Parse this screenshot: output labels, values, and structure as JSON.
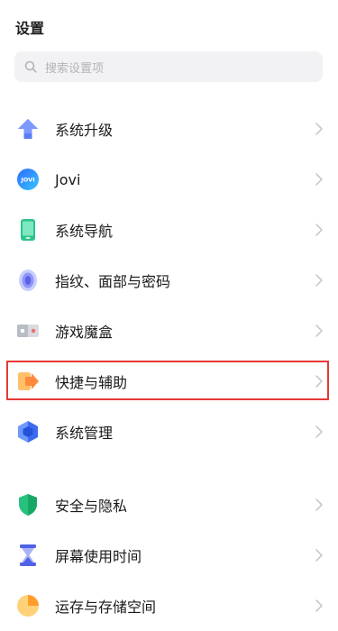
{
  "header": {
    "title": "设置"
  },
  "search": {
    "placeholder": "搜索设置项"
  },
  "items": [
    {
      "id": "system-upgrade",
      "label": "系统升级",
      "icon": "upgrade-arrow-icon"
    },
    {
      "id": "jovi",
      "label": "Jovi",
      "icon": "jovi-icon",
      "icon_text": "JOVI"
    },
    {
      "id": "system-navigation",
      "label": "系统导航",
      "icon": "phone-nav-icon"
    },
    {
      "id": "fingerprint-face-password",
      "label": "指纹、面部与密码",
      "icon": "fingerprint-icon"
    },
    {
      "id": "game-box",
      "label": "游戏魔盒",
      "icon": "game-box-icon"
    },
    {
      "id": "shortcuts-assist",
      "label": "快捷与辅助",
      "icon": "shortcut-icon",
      "highlighted": true
    },
    {
      "id": "system-management",
      "label": "系统管理",
      "icon": "system-manage-icon"
    },
    {
      "id": "security-privacy",
      "label": "安全与隐私",
      "icon": "shield-icon"
    },
    {
      "id": "screen-time",
      "label": "屏幕使用时间",
      "icon": "hourglass-icon"
    },
    {
      "id": "storage",
      "label": "运存与存储空间",
      "icon": "storage-pie-icon"
    }
  ],
  "colors": {
    "highlight_border": "#e53935",
    "chevron": "#c4c4c8",
    "search_bg": "#f2f2f4"
  }
}
